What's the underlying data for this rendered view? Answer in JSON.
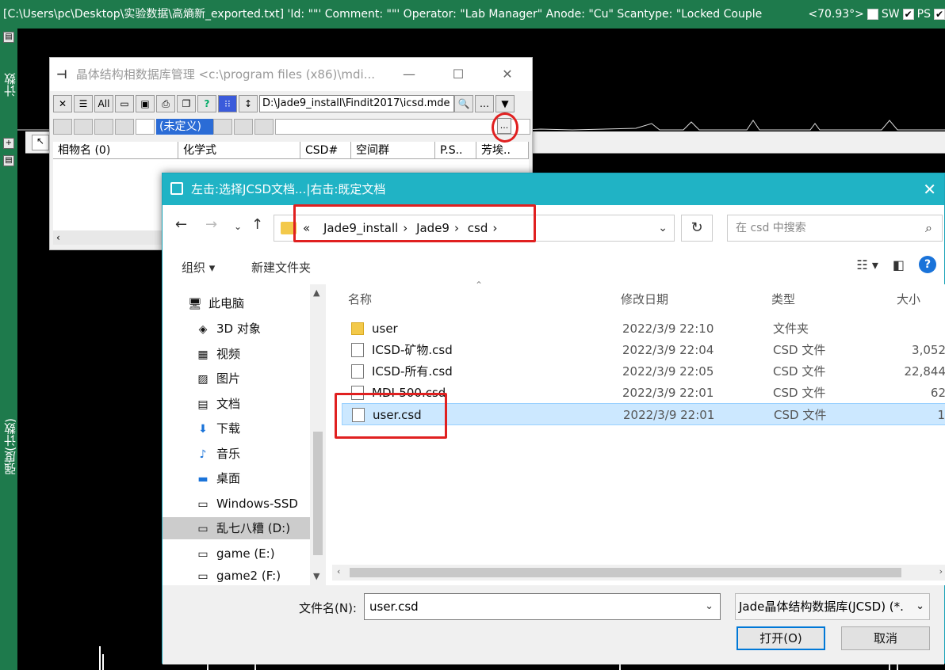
{
  "jade": {
    "title_bar_text": "[C:\\Users\\pc\\Desktop\\实验数据\\高熵新_exported.txt] 'Id: \"\"' Comment: \"\"' Operator: \"Lab Manager\" Anode: \"Cu\" Scantype: \"Locked Couple",
    "angle_readout": "<70.93°>",
    "sw_label": "SW",
    "ps_label": "PS",
    "left_label_top": "计数",
    "left_label_bottom": "强度(计数)"
  },
  "icsd": {
    "title": "晶体结构相数据库管理 <c:\\program files (x86)\\mdi...",
    "toolbar": {
      "all_label": "All",
      "path_value": "D:\\Jade9_install\\Findit2017\\icsd.mde",
      "undefined_label": "(未定义)",
      "browse_button_label": "..."
    },
    "columns": [
      "相物名 (0)",
      "化学式",
      "CSD#",
      "空间群",
      "P.S..",
      "芳埃.."
    ]
  },
  "dialog": {
    "title": "左击:选择JCSD文档...|右击:既定文档",
    "breadcrumb": [
      "«",
      "Jade9_install",
      "Jade9",
      "csd"
    ],
    "search_placeholder": "在 csd 中搜索",
    "organize_label": "组织 ▾",
    "new_folder_label": "新建文件夹",
    "nav_items": [
      {
        "label": "此电脑",
        "icon": "computer-icon"
      },
      {
        "label": "3D 对象",
        "icon": "cube-icon"
      },
      {
        "label": "视频",
        "icon": "video-icon"
      },
      {
        "label": "图片",
        "icon": "picture-icon"
      },
      {
        "label": "文档",
        "icon": "document-icon"
      },
      {
        "label": "下载",
        "icon": "download-icon"
      },
      {
        "label": "音乐",
        "icon": "music-icon"
      },
      {
        "label": "桌面",
        "icon": "desktop-icon"
      },
      {
        "label": "Windows-SSD",
        "icon": "drive-icon"
      },
      {
        "label": "乱七八糟 (D:)",
        "icon": "drive-icon"
      },
      {
        "label": "game (E:)",
        "icon": "drive-icon"
      },
      {
        "label": "game2 (F:)",
        "icon": "drive-icon"
      }
    ],
    "columns": {
      "name": "名称",
      "date": "修改日期",
      "type": "类型",
      "size": "大小"
    },
    "files": [
      {
        "name": "user",
        "date": "2022/3/9 22:10",
        "type": "文件夹",
        "size": "",
        "icon": "folder-icon"
      },
      {
        "name": "ICSD-矿物.csd",
        "date": "2022/3/9 22:04",
        "type": "CSD 文件",
        "size": "3,052",
        "icon": "file-icon"
      },
      {
        "name": "ICSD-所有.csd",
        "date": "2022/3/9 22:05",
        "type": "CSD 文件",
        "size": "22,844",
        "icon": "file-icon"
      },
      {
        "name": "MDI-500.csd",
        "date": "2022/3/9 22:01",
        "type": "CSD 文件",
        "size": "62",
        "icon": "file-icon"
      },
      {
        "name": "user.csd",
        "date": "2022/3/9 22:01",
        "type": "CSD 文件",
        "size": "1",
        "icon": "file-icon"
      }
    ],
    "filename_label": "文件名(N):",
    "filename_value": "user.csd",
    "filter_value": "Jade晶体结构数据库(JCSD) (*.",
    "open_label": "打开(O)",
    "cancel_label": "取消"
  }
}
